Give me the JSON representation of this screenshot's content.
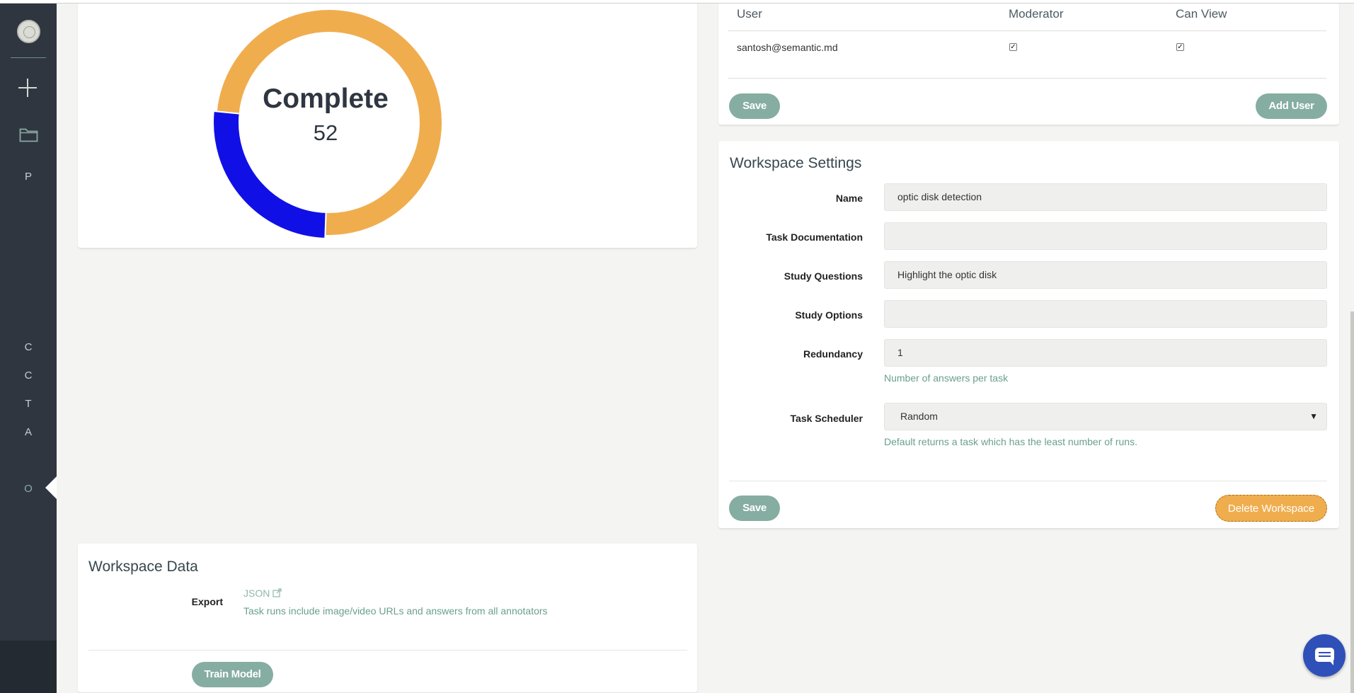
{
  "sidebar": {
    "letters": [
      "P",
      "C",
      "C",
      "T",
      "A",
      "O"
    ]
  },
  "chart_data": {
    "type": "pie",
    "title": "Complete",
    "center_value": "52",
    "slices": [
      {
        "value": 74,
        "color": "#f0ad4e"
      },
      {
        "value": 26,
        "color": "#1010e6"
      }
    ]
  },
  "users_table": {
    "headers": [
      "User",
      "Moderator",
      "Can View"
    ],
    "rows": [
      {
        "user": "santosh@semantic.md",
        "moderator": true,
        "can_view": true
      }
    ],
    "save_label": "Save",
    "add_user_label": "Add User"
  },
  "settings": {
    "title": "Workspace Settings",
    "name_label": "Name",
    "name_value": "optic disk detection",
    "doc_label": "Task Documentation",
    "doc_value": "",
    "questions_label": "Study Questions",
    "questions_value": "Highlight the optic disk",
    "options_label": "Study Options",
    "options_value": "",
    "redundancy_label": "Redundancy",
    "redundancy_value": "1",
    "redundancy_help": "Number of answers per task",
    "scheduler_label": "Task Scheduler",
    "scheduler_value": "Random",
    "scheduler_help": "Default returns a task which has the least number of runs.",
    "save_label": "Save",
    "delete_label": "Delete Workspace"
  },
  "workspace_data": {
    "title": "Workspace Data",
    "export_label": "Export",
    "json_label": "JSON",
    "export_help": "Task runs include image/video URLs and answers from all annotators",
    "train_label": "Train Model"
  }
}
